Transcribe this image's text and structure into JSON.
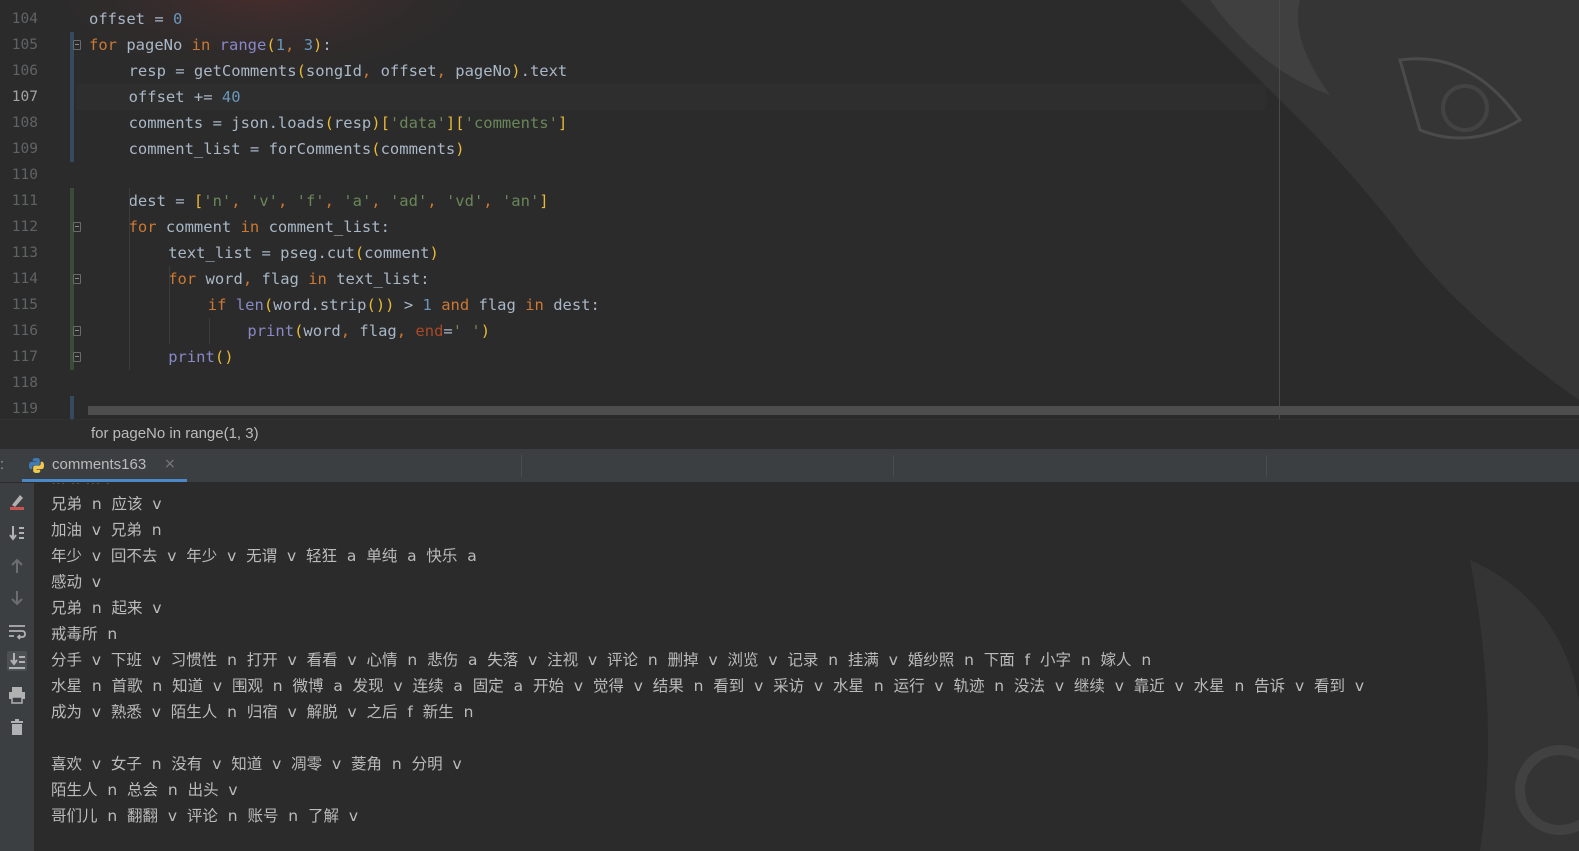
{
  "editor": {
    "current_line": 107,
    "lines": [
      {
        "no": "104",
        "indent": 0,
        "fold": false,
        "tokens": [
          {
            "t": "offset = ",
            "c": ""
          },
          {
            "t": "0",
            "c": "num"
          }
        ]
      },
      {
        "no": "105",
        "indent": 0,
        "fold": true,
        "tokens": [
          {
            "t": "for",
            "c": "kw"
          },
          {
            "t": " pageNo ",
            "c": ""
          },
          {
            "t": "in",
            "c": "kw"
          },
          {
            "t": " ",
            "c": ""
          },
          {
            "t": "range",
            "c": "bi"
          },
          {
            "t": "(",
            "c": "par"
          },
          {
            "t": "1",
            "c": "num"
          },
          {
            "t": ", ",
            "c": "kw"
          },
          {
            "t": "3",
            "c": "num"
          },
          {
            "t": ")",
            "c": "par"
          },
          {
            "t": ":",
            "c": ""
          }
        ]
      },
      {
        "no": "106",
        "indent": 1,
        "fold": false,
        "tokens": [
          {
            "t": "resp = getComments",
            "c": ""
          },
          {
            "t": "(",
            "c": "par"
          },
          {
            "t": "songId",
            "c": ""
          },
          {
            "t": ", ",
            "c": "kw"
          },
          {
            "t": "offset",
            "c": ""
          },
          {
            "t": ", ",
            "c": "kw"
          },
          {
            "t": "pageNo",
            "c": ""
          },
          {
            "t": ")",
            "c": "par"
          },
          {
            "t": ".text",
            "c": ""
          }
        ]
      },
      {
        "no": "107",
        "indent": 1,
        "fold": false,
        "tokens": [
          {
            "t": "offset += ",
            "c": ""
          },
          {
            "t": "40",
            "c": "num"
          }
        ]
      },
      {
        "no": "108",
        "indent": 1,
        "fold": false,
        "tokens": [
          {
            "t": "comments = json.loads",
            "c": ""
          },
          {
            "t": "(",
            "c": "par"
          },
          {
            "t": "resp",
            "c": ""
          },
          {
            "t": ")",
            "c": "par"
          },
          {
            "t": "[",
            "c": "par"
          },
          {
            "t": "'data'",
            "c": "str"
          },
          {
            "t": "]",
            "c": "par"
          },
          {
            "t": "[",
            "c": "par"
          },
          {
            "t": "'comments'",
            "c": "str"
          },
          {
            "t": "]",
            "c": "par"
          }
        ]
      },
      {
        "no": "109",
        "indent": 1,
        "fold": false,
        "tokens": [
          {
            "t": "comment_list = forComments",
            "c": ""
          },
          {
            "t": "(",
            "c": "par"
          },
          {
            "t": "comments",
            "c": ""
          },
          {
            "t": ")",
            "c": "par"
          }
        ]
      },
      {
        "no": "110",
        "indent": 0,
        "fold": false,
        "tokens": []
      },
      {
        "no": "111",
        "indent": 1,
        "fold": false,
        "tokens": [
          {
            "t": "dest = ",
            "c": ""
          },
          {
            "t": "[",
            "c": "par"
          },
          {
            "t": "'n'",
            "c": "str"
          },
          {
            "t": ", ",
            "c": "kw"
          },
          {
            "t": "'v'",
            "c": "str"
          },
          {
            "t": ", ",
            "c": "kw"
          },
          {
            "t": "'f'",
            "c": "str"
          },
          {
            "t": ", ",
            "c": "kw"
          },
          {
            "t": "'a'",
            "c": "str"
          },
          {
            "t": ", ",
            "c": "kw"
          },
          {
            "t": "'ad'",
            "c": "str"
          },
          {
            "t": ", ",
            "c": "kw"
          },
          {
            "t": "'vd'",
            "c": "str"
          },
          {
            "t": ", ",
            "c": "kw"
          },
          {
            "t": "'an'",
            "c": "str"
          },
          {
            "t": "]",
            "c": "par"
          }
        ]
      },
      {
        "no": "112",
        "indent": 1,
        "fold": true,
        "tokens": [
          {
            "t": "for",
            "c": "kw"
          },
          {
            "t": " comment ",
            "c": ""
          },
          {
            "t": "in",
            "c": "kw"
          },
          {
            "t": " comment_list:",
            "c": ""
          }
        ]
      },
      {
        "no": "113",
        "indent": 2,
        "fold": false,
        "tokens": [
          {
            "t": "text_list = pseg.cut",
            "c": ""
          },
          {
            "t": "(",
            "c": "par"
          },
          {
            "t": "comment",
            "c": ""
          },
          {
            "t": ")",
            "c": "par"
          }
        ]
      },
      {
        "no": "114",
        "indent": 2,
        "fold": true,
        "tokens": [
          {
            "t": "for",
            "c": "kw"
          },
          {
            "t": " word",
            "c": ""
          },
          {
            "t": ", ",
            "c": "kw"
          },
          {
            "t": "flag ",
            "c": ""
          },
          {
            "t": "in",
            "c": "kw"
          },
          {
            "t": " text_list:",
            "c": ""
          }
        ]
      },
      {
        "no": "115",
        "indent": 3,
        "fold": false,
        "tokens": [
          {
            "t": "if",
            "c": "kw"
          },
          {
            "t": " ",
            "c": ""
          },
          {
            "t": "len",
            "c": "bi"
          },
          {
            "t": "(",
            "c": "par"
          },
          {
            "t": "word.strip",
            "c": ""
          },
          {
            "t": "()",
            "c": "par"
          },
          {
            "t": ")",
            "c": "par"
          },
          {
            "t": " > ",
            "c": ""
          },
          {
            "t": "1",
            "c": "num"
          },
          {
            "t": " ",
            "c": ""
          },
          {
            "t": "and",
            "c": "kw"
          },
          {
            "t": " flag ",
            "c": ""
          },
          {
            "t": "in",
            "c": "kw"
          },
          {
            "t": " dest:",
            "c": ""
          }
        ]
      },
      {
        "no": "116",
        "indent": 4,
        "fold": true,
        "tokens": [
          {
            "t": "print",
            "c": "bi"
          },
          {
            "t": "(",
            "c": "par"
          },
          {
            "t": "word",
            "c": ""
          },
          {
            "t": ", ",
            "c": "kw"
          },
          {
            "t": "flag",
            "c": ""
          },
          {
            "t": ", ",
            "c": "kw"
          },
          {
            "t": "end",
            "c": "kwa"
          },
          {
            "t": "=",
            "c": ""
          },
          {
            "t": "' '",
            "c": "str"
          },
          {
            "t": ")",
            "c": "par"
          }
        ]
      },
      {
        "no": "117",
        "indent": 2,
        "fold": true,
        "tokens": [
          {
            "t": "print",
            "c": "bi"
          },
          {
            "t": "()",
            "c": "par"
          }
        ]
      },
      {
        "no": "118",
        "indent": 0,
        "fold": false,
        "tokens": []
      },
      {
        "no": "119",
        "indent": 0,
        "fold": false,
        "tokens": []
      }
    ]
  },
  "breadcrumb": {
    "text": "for pageNo in range(1, 3)"
  },
  "run_panel": {
    "tab_label": "comments163",
    "close_glyph": "×",
    "left_marker": ":",
    "tools": [
      "clear-output-icon",
      "scroll-to-end-icon",
      "up-arrow-icon",
      "down-arrow-icon",
      "soft-wrap-icon",
      "scroll-to-bottom-icon",
      "print-icon",
      "trash-icon"
    ]
  },
  "console": {
    "lines": [
      "兄弟  n  应该  v",
      "加油  v  兄弟  n",
      "年少  v  回不去  v  年少  v  无谓  v  轻狂  a  单纯  a  快乐  a",
      "感动  v",
      "兄弟  n  起来  v",
      "戒毒所  n",
      "分手  v  下班  v  习惯性  n  打开  v  看看  v  心情  n  悲伤  a  失落  v  注视  v  评论  n  删掉  v  浏览  v  记录  n  挂满  v  婚纱照  n  下面  f  小字  n  嫁人  n",
      "水星  n  首歌  n  知道  v  围观  n  微博  a  发现  v  连续  a  固定  a  开始  v  觉得  v  结果  n  看到  v  采访  v  水星  n  运行  v  轨迹  n  没法  v  继续  v  靠近  v  水星  n  告诉  v  看到  v",
      "成为  v  熟悉  v  陌生人  n  归宿  v  解脱  v  之后  f  新生  n",
      "",
      "喜欢  v  女子  n  没有  v  知道  v  凋零  v  菱角  n  分明  v",
      "陌生人  n  总会  n  出头  v",
      "哥们儿  n  翻翻  v  评论  n  账号  n  了解  v"
    ]
  },
  "colors": {
    "editor_bg": "#2b2b2b",
    "keyword": "#cc7832",
    "number": "#6897bb",
    "string": "#6a8759",
    "builtin": "#8888c6",
    "paren": "#e8ba36",
    "text": "#a9b7c6",
    "tab_underline": "#4a88c7"
  }
}
